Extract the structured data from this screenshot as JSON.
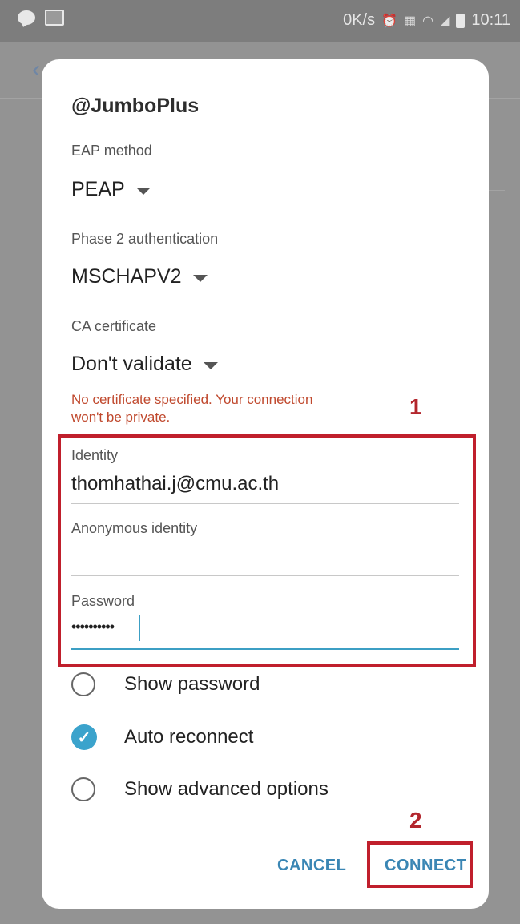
{
  "status_bar": {
    "speed": "0K/s",
    "time": "10:11",
    "icons": [
      "chat-icon",
      "image-icon",
      "alarm-icon",
      "volte-icon",
      "wifi-icon",
      "signal-icon",
      "battery-icon"
    ]
  },
  "dialog": {
    "network_name": "@JumboPlus",
    "eap_method": {
      "label": "EAP method",
      "value": "PEAP"
    },
    "phase2": {
      "label": "Phase 2 authentication",
      "value": "MSCHAPV2"
    },
    "ca_certificate": {
      "label": "CA certificate",
      "value": "Don't validate"
    },
    "warning_line1": "No certificate specified. Your connection",
    "warning_line2": "won't be private.",
    "identity": {
      "label": "Identity",
      "value": "thomhathai.j@cmu.ac.th"
    },
    "anonymous_identity": {
      "label": "Anonymous identity",
      "value": ""
    },
    "password": {
      "label": "Password",
      "value": "••••••••••"
    },
    "options": {
      "show_password": {
        "label": "Show password",
        "checked": false
      },
      "auto_reconnect": {
        "label": "Auto reconnect",
        "checked": true
      },
      "show_advanced": {
        "label": "Show advanced options",
        "checked": false
      }
    },
    "cancel_label": "CANCEL",
    "connect_label": "CONNECT"
  },
  "annotations": {
    "step1": "1",
    "step2": "2"
  },
  "colors": {
    "accent": "#3c9fc4",
    "warning": "#c0492e",
    "callout": "#c01f2c",
    "button_text": "#3a86b4"
  }
}
